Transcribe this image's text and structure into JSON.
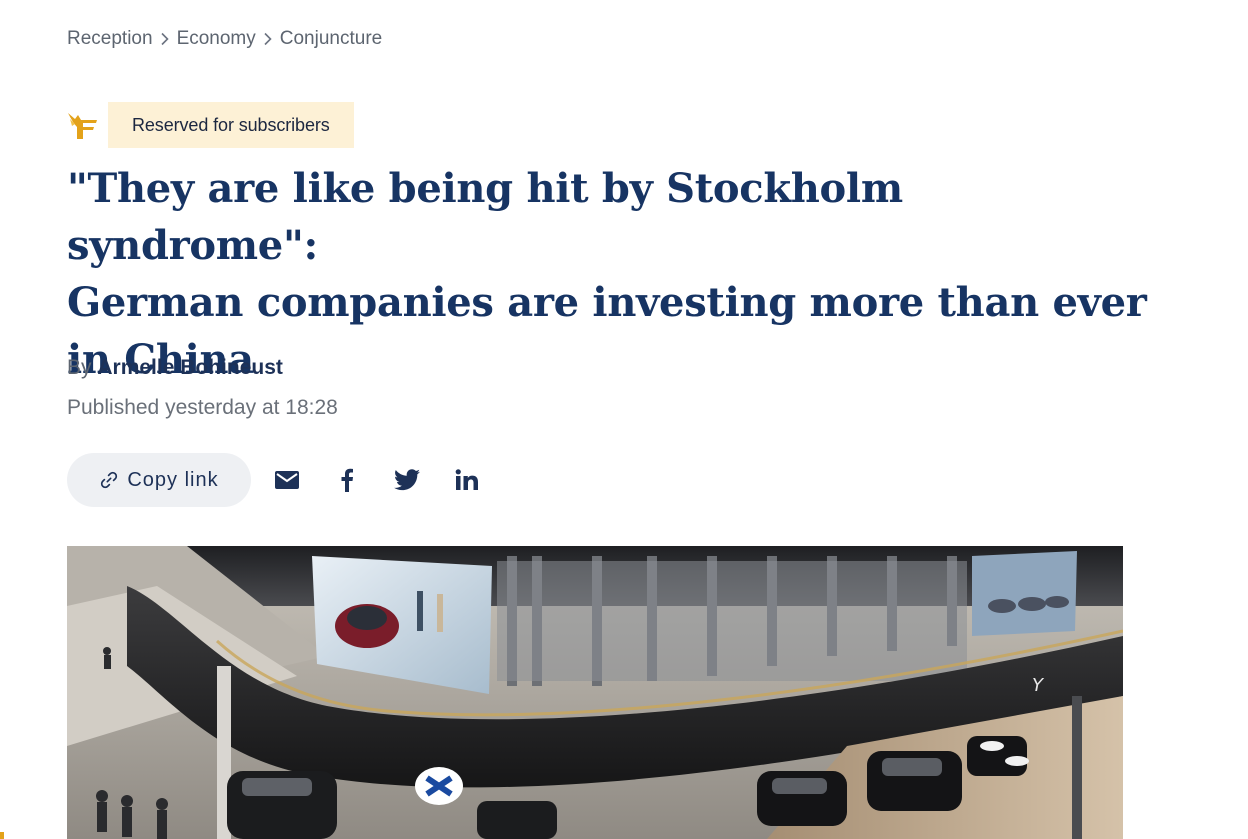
{
  "breadcrumb": {
    "items": [
      "Reception",
      "Economy",
      "Conjuncture"
    ]
  },
  "badge": {
    "logo_icon": "le-figaro-f-logo-icon",
    "label": "Reserved for subscribers"
  },
  "article": {
    "headline_lines": [
      "\"They are like being hit by Stockholm syndrome\":",
      "German companies are investing more than ever",
      "in China"
    ],
    "by_prefix": "By",
    "author": "Armelle Bohineust",
    "published": "Published yesterday at 18:28"
  },
  "share": {
    "copy_link_label": "Copy link",
    "icons": [
      "mail-icon",
      "facebook-icon",
      "twitter-icon",
      "linkedin-icon"
    ]
  },
  "hero_image": {
    "description_icon": "photo"
  },
  "colors": {
    "headline": "#173463",
    "author": "#1d3157",
    "muted_text": "#5d6570",
    "badge_bg": "#fdf1d6",
    "logo_gold": "#e3a21a",
    "copy_btn_bg": "#eef0f3",
    "icon": "#1d3157"
  }
}
